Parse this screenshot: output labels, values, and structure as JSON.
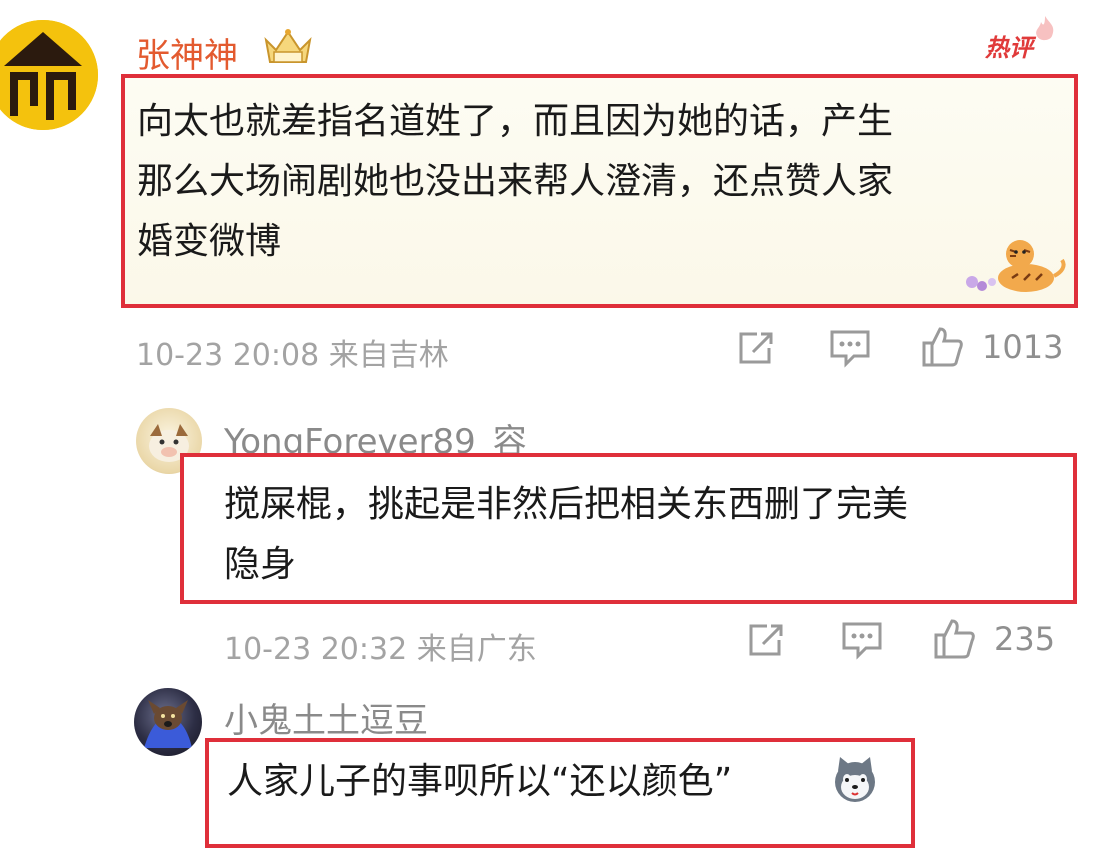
{
  "comments": [
    {
      "username": "张神神",
      "badge": "vip-crown-icon",
      "tag": "热评",
      "text_lines": [
        "向太也就差指名道姓了，而且因为她的话，产生",
        "那么大场闹剧她也没出来帮人澄清，还点赞人家",
        "婚变微博"
      ],
      "sticker": "tiger-sticker",
      "timestamp": "10-23 20:08",
      "location": "来自吉林",
      "likes": "1013"
    },
    {
      "username": "YongForever89_容",
      "text_lines": [
        "搅屎棍，挑起是非然后把相关东西删了完美",
        "隐身"
      ],
      "timestamp": "10-23 20:32",
      "location": "来自广东",
      "likes": "235"
    },
    {
      "username": "小鬼土土逗豆",
      "text_lines": [
        "人家儿子的事呗所以“还以颜色”"
      ],
      "emoji": "husky-emoji"
    }
  ],
  "icons": {
    "share": "share-icon",
    "comment": "comment-icon",
    "like": "thumbs-up-icon"
  },
  "colors": {
    "highlight_border": "#df2f3a",
    "featured_username": "#e35a2f",
    "hot_tag": "#e03a3a",
    "meta_text": "#a3a3a3"
  }
}
